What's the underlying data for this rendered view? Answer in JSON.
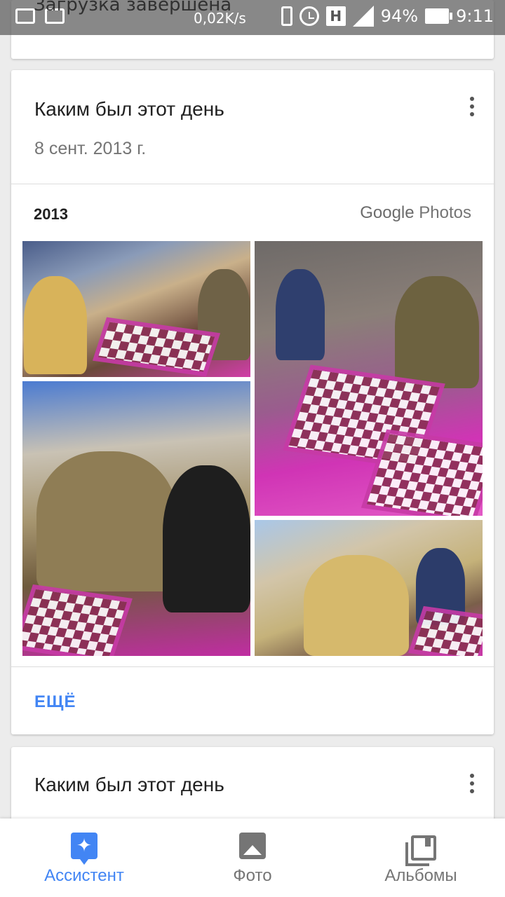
{
  "status_bar": {
    "notification_text": "Загрузка завершена",
    "net_speed": "0,02K/s",
    "network_type": "H",
    "battery": "94%",
    "time": "9:11"
  },
  "cards": [
    {
      "title": "Каким был этот день",
      "date": "8 сент. 2013 г.",
      "year": "2013",
      "brand_google": "Google",
      "brand_photos": "Photos",
      "more_label": "ЕЩЁ"
    },
    {
      "title": "Каким был этот день"
    }
  ],
  "bottom_nav": [
    {
      "label": "Ассистент",
      "icon": "assistant-icon",
      "active": true
    },
    {
      "label": "Фото",
      "icon": "photo-icon",
      "active": false
    },
    {
      "label": "Альбомы",
      "icon": "albums-icon",
      "active": false
    }
  ],
  "colors": {
    "accent": "#4285f4",
    "nav_inactive": "#757575",
    "background": "#ececec"
  }
}
